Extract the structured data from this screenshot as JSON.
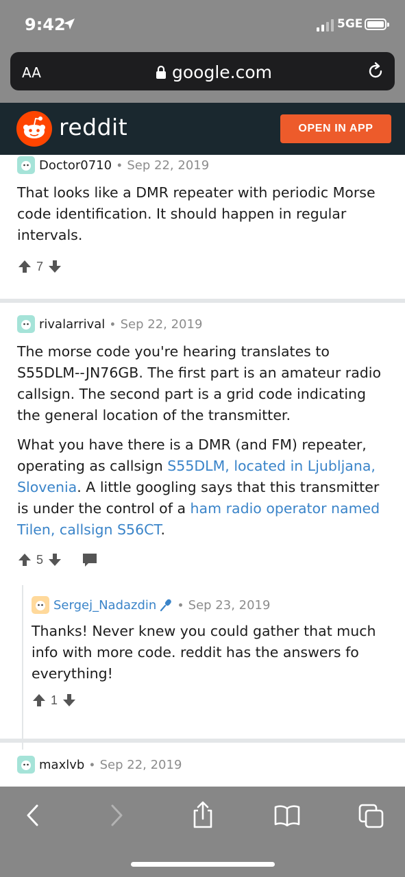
{
  "status": {
    "time": "9:42",
    "network": "5GE"
  },
  "browser": {
    "text_size_label": "AA",
    "domain": "google.com"
  },
  "reddit": {
    "brand": "reddit",
    "open_in_app": "OPEN IN APP"
  },
  "comments": [
    {
      "username": "Doctor0710",
      "date": "Sep 22, 2019",
      "body": [
        "That looks like a DMR repeater with periodic Morse code identification. It should happen in regular intervals."
      ],
      "score": "7"
    },
    {
      "username": "rivalarrival",
      "date": "Sep 22, 2019",
      "p1": "The morse code you're hearing translates to S55DLM--JN76GB. The first part is an amateur radio callsign. The second part is a grid code indicating the general location of the transmitter.",
      "p2_a": "What you have there is a DMR (and FM) repeater, operating as callsign ",
      "p2_link1": "S55DLM, located in Ljubljana, Slovenia",
      "p2_b": ". A little googling says that this transmitter is under the control of a ",
      "p2_link2": "ham radio operator named Tilen, callsign S56CT",
      "p2_c": ".",
      "score": "5"
    },
    {
      "username": "Sergej_Nadazdin",
      "date": "Sep 23, 2019",
      "body": "Thanks! Never knew you could gather that much info with more code. reddit has the answers fo everything!",
      "score": "1"
    },
    {
      "username": "maxlvb",
      "date": "Sep 22, 2019"
    }
  ],
  "colors": {
    "accent": "#ed5b2b",
    "link": "#3a84c9",
    "header_bg": "#1a282f"
  },
  "icons": {
    "toolbar": [
      "back-icon",
      "forward-icon",
      "share-icon",
      "bookmarks-icon",
      "tabs-icon"
    ]
  }
}
